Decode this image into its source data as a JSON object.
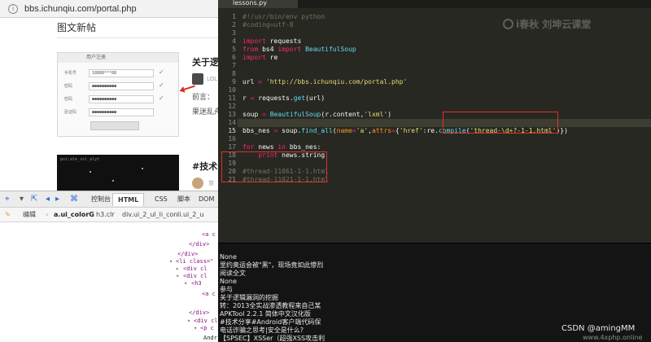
{
  "browser": {
    "url": "bbs.ichunqiu.com/portal.php",
    "section_title": "图文新帖",
    "login_form": {
      "heading": "用户注册",
      "rows": [
        {
          "label": "手机号",
          "value": "18888***88"
        },
        {
          "label": "密码",
          "value": "●●●●●●●●●●"
        },
        {
          "label": "密码",
          "value": "●●●●●●●●●●"
        },
        {
          "label": "验证码",
          "value": "●●●●●●●●●●"
        }
      ]
    },
    "post1": {
      "title": "关于逻",
      "user": "LOL",
      "line1": "前言：",
      "line2": "果迷乱舟"
    },
    "post2": {
      "thumb_text": "poi:ate_xxl_alyt",
      "title": "#技术分",
      "user": "京"
    }
  },
  "devtools": {
    "tabs": [
      {
        "label": "控制台"
      },
      {
        "label": "HTML",
        "active": true
      },
      {
        "label": "CSS"
      },
      {
        "label": "脚本"
      },
      {
        "label": "DOM"
      }
    ],
    "crumbs": [
      "编辑",
      "a.ui_colorG",
      "h3.clr",
      "div.ui_2_ul_li_con",
      "li.ui_2_u"
    ],
    "tree": [
      "<a c",
      "</div>",
      "</div>",
      "<li class=\"",
      "<div cl",
      "<div cl",
      "<h3",
      "<a c",
      "</div>",
      "<div cl",
      "<p c",
      "Andr"
    ]
  },
  "editor": {
    "tab_label": "lessons.py",
    "current_line": 15,
    "lines": [
      {
        "n": 1,
        "text": "#!/usr/bin/env python"
      },
      {
        "n": 2,
        "text": "#coding=utf-8"
      },
      {
        "n": 3,
        "text": ""
      },
      {
        "n": 4,
        "text": "import requests"
      },
      {
        "n": 5,
        "text": "from bs4 import BeautifulSoup"
      },
      {
        "n": 6,
        "text": "import re"
      },
      {
        "n": 7,
        "text": ""
      },
      {
        "n": 8,
        "text": ""
      },
      {
        "n": 9,
        "text": "url = 'http://bbs.ichunqiu.com/portal.php'"
      },
      {
        "n": 10,
        "text": ""
      },
      {
        "n": 11,
        "text": "r = requests.get(url)"
      },
      {
        "n": 12,
        "text": ""
      },
      {
        "n": 13,
        "text": "soup = BeautifulSoup(r.content,'lxml')"
      },
      {
        "n": 14,
        "text": ""
      },
      {
        "n": 15,
        "text": "bbs_nes = soup.find_all(name='a',attrs={'href':re.compile('thread-\\d+?-1-1.html')})"
      },
      {
        "n": 16,
        "text": ""
      },
      {
        "n": 17,
        "text": "for news in bbs_nes:"
      },
      {
        "n": 18,
        "text": "    print news.string"
      },
      {
        "n": 19,
        "text": ""
      },
      {
        "n": 20,
        "text": "#thread-11061-1-1.html"
      },
      {
        "n": 21,
        "text": "#thread-11021-1-1.html"
      }
    ],
    "watermark": "i春秋  刘坤云课堂"
  },
  "console": {
    "lines": [
      "None",
      "里约奥运会被\"黑\"，现场竟如此惨烈",
      "阅读全文",
      "None",
      "参与",
      "关于逻辑漏洞的挖掘",
      "转：2013全实战渗透教程来自己某",
      "APKTool 2.2.1 简体中文汉化版",
      "#技术分享#Android客户端代码保",
      "电话诈骗之思考|安全是什么?",
      "【SPSEC】XSSer（超强XSS攻击利"
    ]
  },
  "credit": {
    "main": "CSDN @amingMM",
    "site": "www.4xphp.online"
  }
}
